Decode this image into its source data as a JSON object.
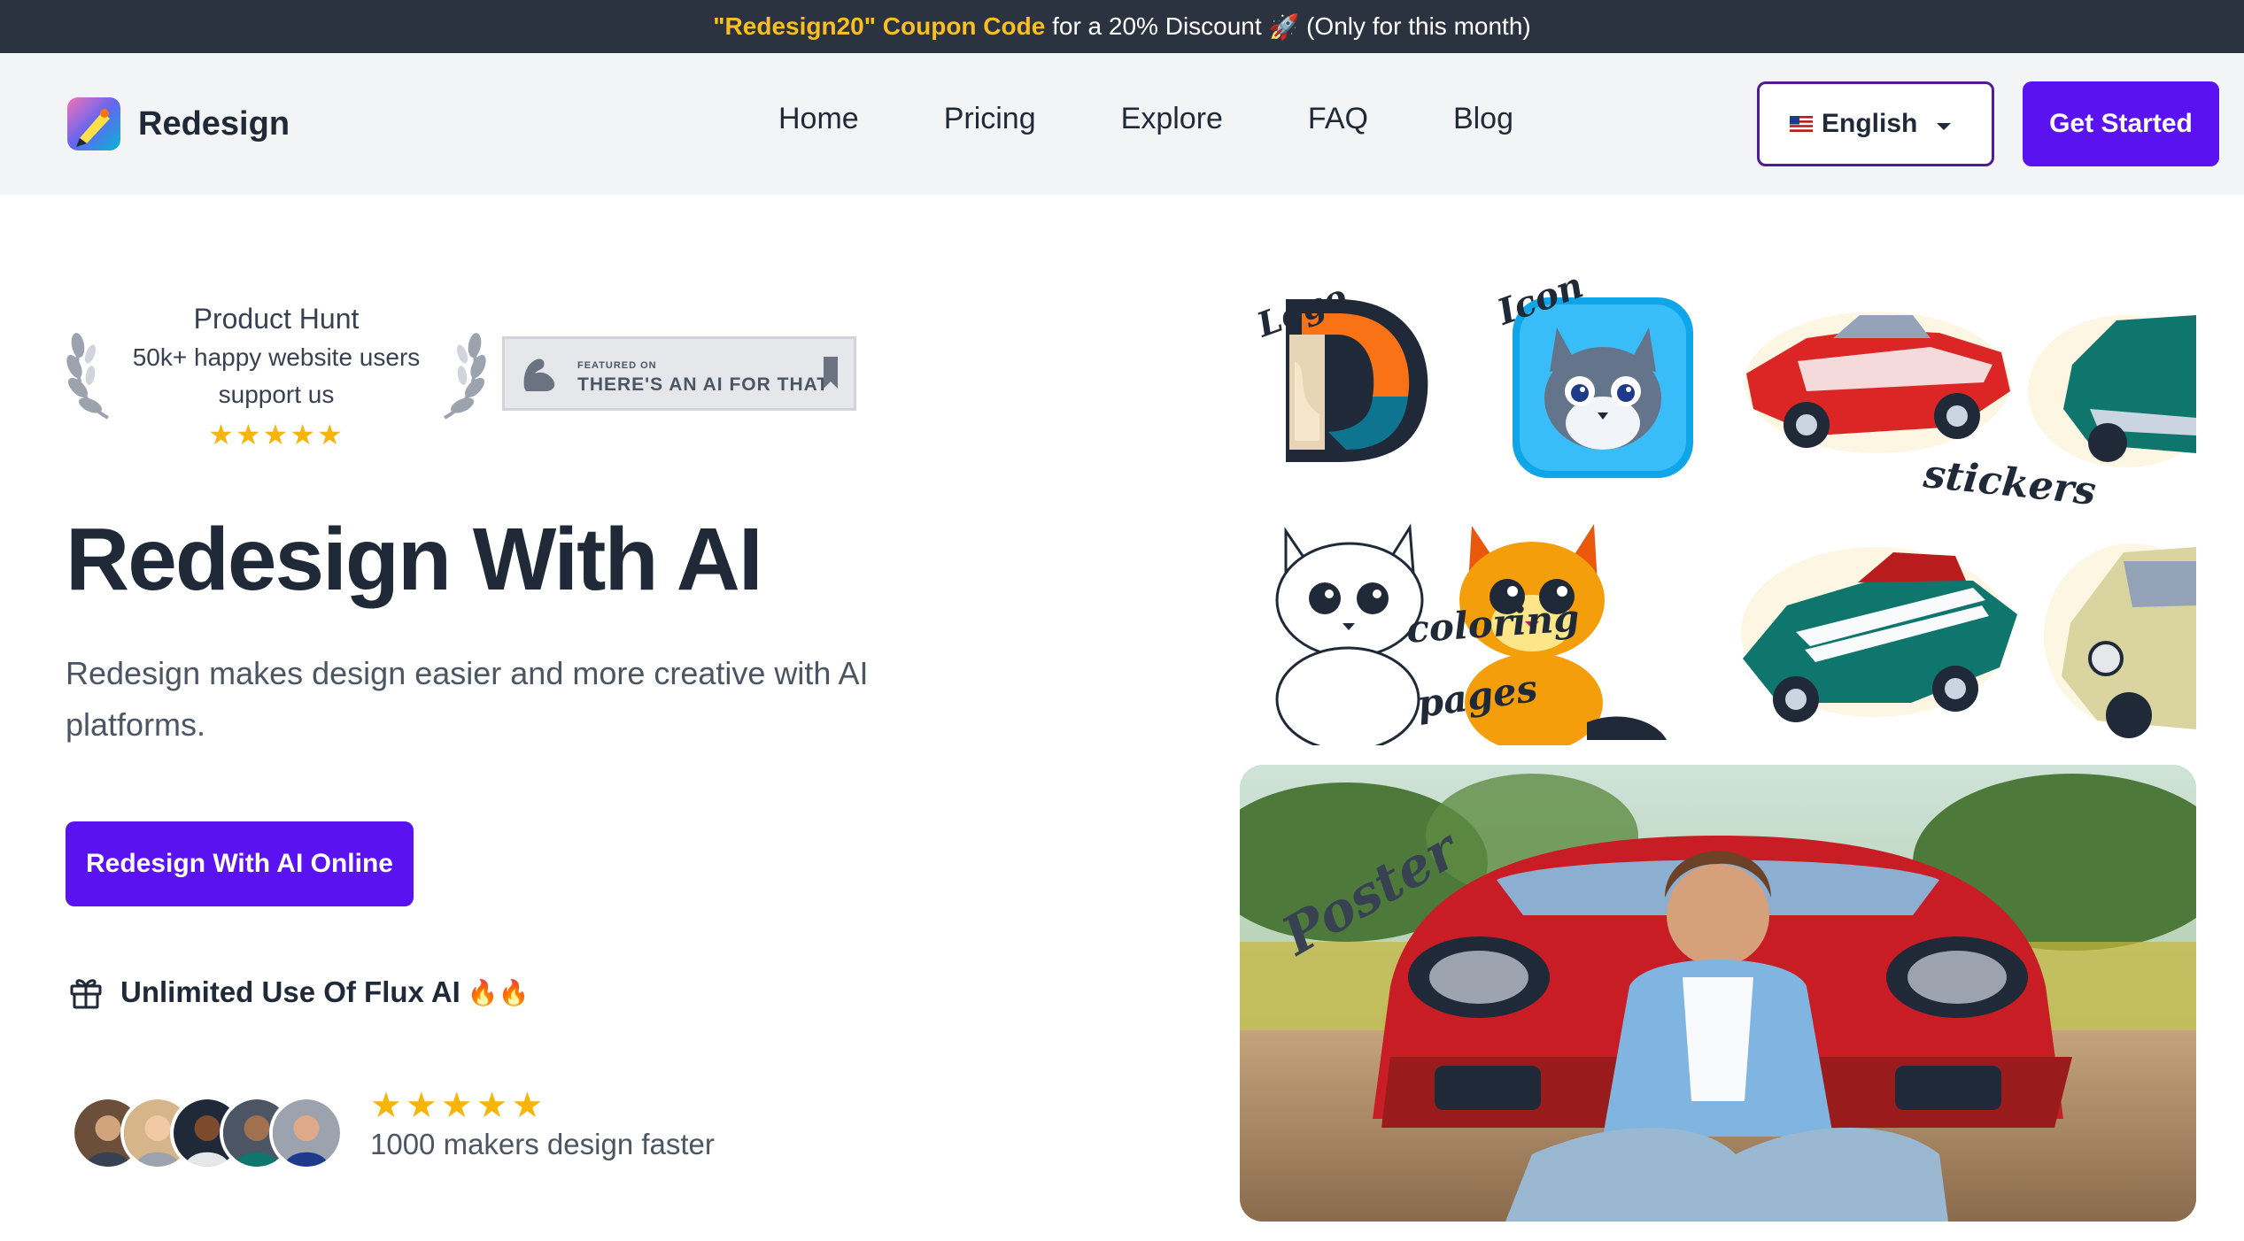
{
  "promo": {
    "code": "\"Redesign20\" Coupon Code",
    "rest": " for a 20% Discount ",
    "rocket": "🚀",
    "suffix": " (Only for this month)"
  },
  "header": {
    "brand": "Redesign",
    "nav": [
      "Home",
      "Pricing",
      "Explore",
      "FAQ",
      "Blog"
    ],
    "language": "English",
    "get_started": "Get Started"
  },
  "product_hunt": {
    "title": "Product Hunt",
    "line1": "50k+ happy website users",
    "line2": "support us",
    "stars": "★★★★★"
  },
  "ai_badge": {
    "featured": "FEATURED ON",
    "tagline": "THERE'S AN AI FOR THAT"
  },
  "hero": {
    "title": "Redesign With AI",
    "description": "Redesign makes design easier and more creative with AI platforms.",
    "cta": "Redesign With AI Online"
  },
  "feature": {
    "text": "Unlimited Use Of Flux AI",
    "emoji": "🔥🔥"
  },
  "social_proof": {
    "stars": "★★★★★",
    "text": "1000 makers design faster",
    "avatar_count": 5
  },
  "gallery": {
    "labels": {
      "logo": "Logo",
      "icon": "Icon",
      "stickers": "stickers",
      "coloring": "coloring",
      "pages": "pages",
      "poster": "Poster"
    }
  },
  "colors": {
    "accent": "#5b12f0",
    "promo_bg": "#2b3340",
    "promo_code": "#fbbf24",
    "stars": "#f5b50a",
    "nav_bg": "#f3f4f6"
  },
  "icons": [
    "brand-logo-icon",
    "flag-us-icon",
    "caret-down-icon",
    "laurel-left-icon",
    "laurel-right-icon",
    "gift-icon",
    "bookmark-icon"
  ]
}
